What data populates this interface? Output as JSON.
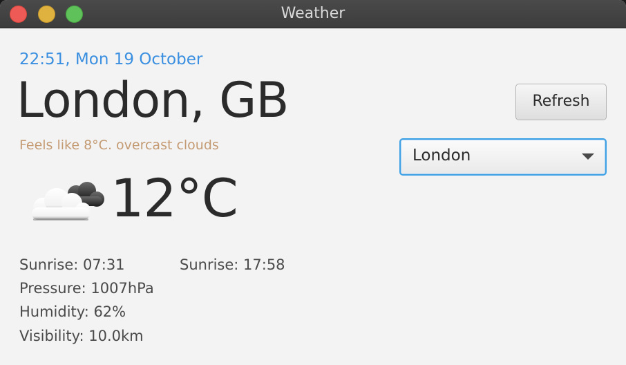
{
  "window": {
    "title": "Weather"
  },
  "weather": {
    "datetime": "22:51, Mon 19 October",
    "location": "London, GB",
    "feels_like": "Feels like 8°C. overcast clouds",
    "icon": "cloud-sun-icon",
    "temperature": "12°C"
  },
  "stats": {
    "sunrise": "Sunrise: 07:31",
    "sunset": "Sunrise: 17:58",
    "pressure": "Pressure: 1007hPa",
    "humidity": "Humidity: 62%",
    "visibility": "Visibility: 10.0km"
  },
  "controls": {
    "refresh_label": "Refresh",
    "city_selected": "London"
  },
  "colors": {
    "datetime": "#3a8fe0",
    "feels_like": "#c49a72",
    "select_focus": "#3ea1e6"
  }
}
